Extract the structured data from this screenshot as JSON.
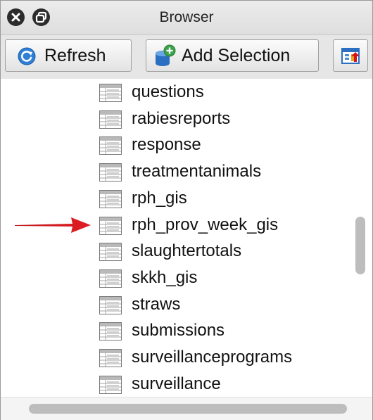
{
  "window": {
    "title": "Browser"
  },
  "toolbar": {
    "refresh_label": "Refresh",
    "add_selection_label": "Add Selection",
    "refresh_icon": "refresh-icon",
    "add_selection_icon": "add-database-icon",
    "export_icon": "export-icon"
  },
  "list": {
    "item_icon": "table-icon",
    "items": [
      {
        "label": "questions"
      },
      {
        "label": "rabiesreports"
      },
      {
        "label": "response"
      },
      {
        "label": "treatmentanimals"
      },
      {
        "label": "rph_gis"
      },
      {
        "label": "rph_prov_week_gis"
      },
      {
        "label": "slaughtertotals"
      },
      {
        "label": "skkh_gis"
      },
      {
        "label": "straws"
      },
      {
        "label": "submissions"
      },
      {
        "label": "surveillanceprograms"
      },
      {
        "label": "surveillance"
      }
    ],
    "highlighted_index": 5
  },
  "colors": {
    "arrow": "#d0161c",
    "refresh_blue": "#2f7fd6",
    "add_green": "#3aa34a",
    "add_blue": "#2b6fc0"
  }
}
